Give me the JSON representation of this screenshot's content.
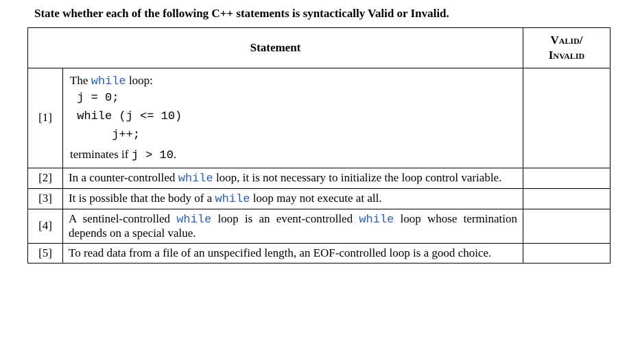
{
  "prompt": "State whether each of the following C++ statements is syntactically Valid or Invalid.",
  "headers": {
    "statement": "Statement",
    "valid_line1": "Valid/",
    "valid_line2": "Invalid"
  },
  "rows": [
    {
      "idx": "[1]",
      "intro_prefix": "The ",
      "intro_kw": "while",
      "intro_suffix": " loop:",
      "code_l1": " j = 0;",
      "code_l2": " while (j <= 10)",
      "code_l3": "      j++;",
      "term_prefix": "terminates if ",
      "term_code": "j > 10",
      "term_suffix": ".",
      "answer": ""
    },
    {
      "idx": "[2]",
      "pre": "In a counter-controlled ",
      "kw": "while",
      "post": " loop, it is not necessary to initialize the loop control variable.",
      "answer": ""
    },
    {
      "idx": "[3]",
      "pre": "It is possible that the body of a ",
      "kw": "while",
      "post": " loop may not execute at all.",
      "answer": ""
    },
    {
      "idx": "[4]",
      "pre": "A sentinel-controlled ",
      "kw": "while",
      "mid": " loop is an event-controlled ",
      "kw2": "while",
      "post": " loop whose termination depends on a special value.",
      "answer": ""
    },
    {
      "idx": "[5]",
      "pre": "To read data from a file of an unspecified length, an EOF-controlled loop is a good choice.",
      "answer": ""
    }
  ]
}
